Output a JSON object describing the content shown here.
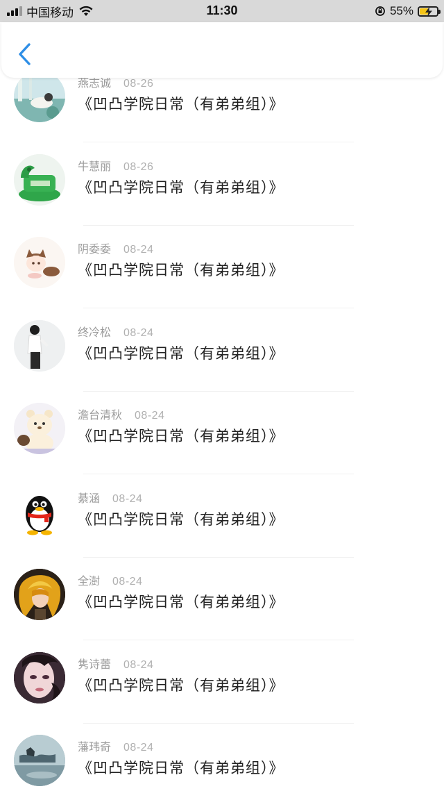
{
  "status_bar": {
    "carrier": "中国移动",
    "time": "11:30",
    "battery": "55%",
    "battery_level": 0.55,
    "battery_color": "#f5c518"
  },
  "header": {
    "back_icon": "chevron-left-icon",
    "accent": "#2e8ee6"
  },
  "items": [
    {
      "name": "燕志诚",
      "date": "08-26",
      "title": "《凹凸学院日常（有弟弟组）》",
      "avatar": "avatar-photo"
    },
    {
      "name": "牛慧丽",
      "date": "08-26",
      "title": "《凹凸学院日常（有弟弟组）》",
      "avatar": "avatar-green-dragon"
    },
    {
      "name": "阴委委",
      "date": "08-24",
      "title": "《凹凸学院日常（有弟弟组）》",
      "avatar": "avatar-anime-cat"
    },
    {
      "name": "终冷松",
      "date": "08-24",
      "title": "《凹凸学院日常（有弟弟组）》",
      "avatar": "avatar-person"
    },
    {
      "name": "澹台清秋",
      "date": "08-24",
      "title": "《凹凸学院日常（有弟弟组）》",
      "avatar": "avatar-bear"
    },
    {
      "name": "綦涵",
      "date": "08-24",
      "title": "《凹凸学院日常（有弟弟组）》",
      "avatar": "avatar-qq-penguin"
    },
    {
      "name": "全澍",
      "date": "08-24",
      "title": "《凹凸学院日常（有弟弟组）》",
      "avatar": "avatar-anime-blonde"
    },
    {
      "name": "隽诗蕾",
      "date": "08-24",
      "title": "《凹凸学院日常（有弟弟组）》",
      "avatar": "avatar-face"
    },
    {
      "name": "藩玮奇",
      "date": "08-24",
      "title": "《凹凸学院日常（有弟弟组）》",
      "avatar": "avatar-landscape"
    }
  ]
}
